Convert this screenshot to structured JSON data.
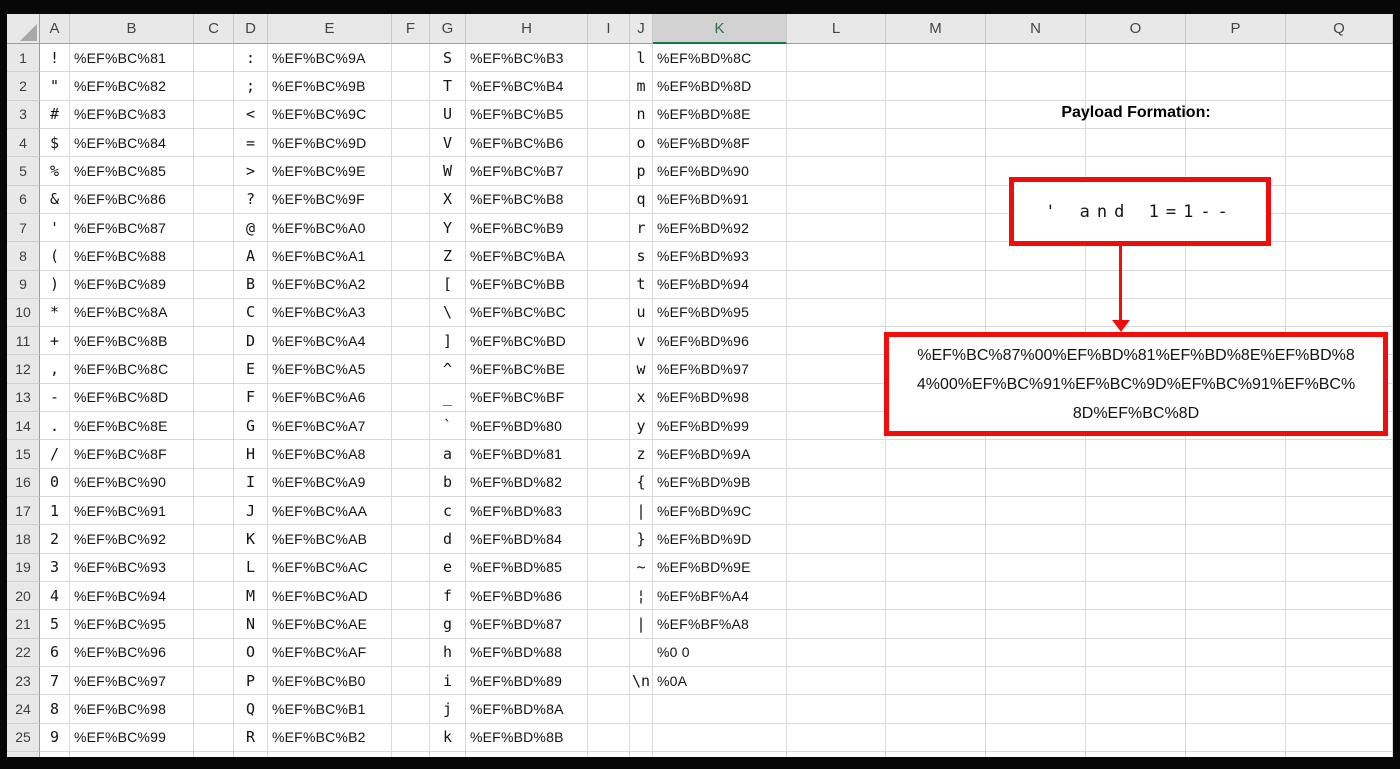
{
  "sheet": {
    "column_headers": [
      "A",
      "B",
      "C",
      "D",
      "E",
      "F",
      "G",
      "H",
      "I",
      "J",
      "K",
      "L",
      "M",
      "N",
      "O",
      "P",
      "Q"
    ],
    "selected_column": "K",
    "row_numbers": [
      1,
      2,
      3,
      4,
      5,
      6,
      7,
      8,
      9,
      10,
      11,
      12,
      13,
      14,
      15,
      16,
      17,
      18,
      19,
      20,
      21,
      22,
      23,
      24,
      25
    ],
    "groups": [
      {
        "char_col": "A",
        "code_col": "B",
        "chars": [
          "!",
          "\"",
          "#",
          "$",
          "%",
          "&",
          "'",
          "(",
          ")",
          "*",
          "+",
          ",",
          "-",
          ".",
          "/",
          "0",
          "1",
          "2",
          "3",
          "4",
          "5",
          "6",
          "7",
          "8",
          "9"
        ],
        "codes": [
          "%EF%BC%81",
          "%EF%BC%82",
          "%EF%BC%83",
          "%EF%BC%84",
          "%EF%BC%85",
          "%EF%BC%86",
          "%EF%BC%87",
          "%EF%BC%88",
          "%EF%BC%89",
          "%EF%BC%8A",
          "%EF%BC%8B",
          "%EF%BC%8C",
          "%EF%BC%8D",
          "%EF%BC%8E",
          "%EF%BC%8F",
          "%EF%BC%90",
          "%EF%BC%91",
          "%EF%BC%92",
          "%EF%BC%93",
          "%EF%BC%94",
          "%EF%BC%95",
          "%EF%BC%96",
          "%EF%BC%97",
          "%EF%BC%98",
          "%EF%BC%99"
        ]
      },
      {
        "char_col": "D",
        "code_col": "E",
        "chars": [
          ":",
          ";",
          "<",
          "=",
          ">",
          "?",
          "@",
          "A",
          "B",
          "C",
          "D",
          "E",
          "F",
          "G",
          "H",
          "I",
          "J",
          "K",
          "L",
          "M",
          "N",
          "O",
          "P",
          "Q",
          "R"
        ],
        "codes": [
          "%EF%BC%9A",
          "%EF%BC%9B",
          "%EF%BC%9C",
          "%EF%BC%9D",
          "%EF%BC%9E",
          "%EF%BC%9F",
          "%EF%BC%A0",
          "%EF%BC%A1",
          "%EF%BC%A2",
          "%EF%BC%A3",
          "%EF%BC%A4",
          "%EF%BC%A5",
          "%EF%BC%A6",
          "%EF%BC%A7",
          "%EF%BC%A8",
          "%EF%BC%A9",
          "%EF%BC%AA",
          "%EF%BC%AB",
          "%EF%BC%AC",
          "%EF%BC%AD",
          "%EF%BC%AE",
          "%EF%BC%AF",
          "%EF%BC%B0",
          "%EF%BC%B1",
          "%EF%BC%B2"
        ]
      },
      {
        "char_col": "G",
        "code_col": "H",
        "chars": [
          "S",
          "T",
          "U",
          "V",
          "W",
          "X",
          "Y",
          "Z",
          "[",
          "\\",
          "]",
          "^",
          "_",
          "`",
          "a",
          "b",
          "c",
          "d",
          "e",
          "f",
          "g",
          "h",
          "i",
          "j",
          "k"
        ],
        "codes": [
          "%EF%BC%B3",
          "%EF%BC%B4",
          "%EF%BC%B5",
          "%EF%BC%B6",
          "%EF%BC%B7",
          "%EF%BC%B8",
          "%EF%BC%B9",
          "%EF%BC%BA",
          "%EF%BC%BB",
          "%EF%BC%BC",
          "%EF%BC%BD",
          "%EF%BC%BE",
          "%EF%BC%BF",
          "%EF%BD%80",
          "%EF%BD%81",
          "%EF%BD%82",
          "%EF%BD%83",
          "%EF%BD%84",
          "%EF%BD%85",
          "%EF%BD%86",
          "%EF%BD%87",
          "%EF%BD%88",
          "%EF%BD%89",
          "%EF%BD%8A",
          "%EF%BD%8B"
        ]
      },
      {
        "char_col": "J",
        "code_col": "K",
        "chars": [
          "l",
          "m",
          "n",
          "o",
          "p",
          "q",
          "r",
          "s",
          "t",
          "u",
          "v",
          "w",
          "x",
          "y",
          "z",
          "{",
          "|",
          "}",
          "~",
          "¦",
          "|",
          "",
          "\\n",
          "",
          ""
        ],
        "codes": [
          "%EF%BD%8C",
          "%EF%BD%8D",
          "%EF%BD%8E",
          "%EF%BD%8F",
          "%EF%BD%90",
          "%EF%BD%91",
          "%EF%BD%92",
          "%EF%BD%93",
          "%EF%BD%94",
          "%EF%BD%95",
          "%EF%BD%96",
          "%EF%BD%97",
          "%EF%BD%98",
          "%EF%BD%99",
          "%EF%BD%9A",
          "%EF%BD%9B",
          "%EF%BD%9C",
          "%EF%BD%9D",
          "%EF%BD%9E",
          "%EF%BF%A4",
          "%EF%BF%A8",
          "%0 0",
          "%0A",
          "",
          ""
        ]
      }
    ]
  },
  "annotation": {
    "title": "Payload Formation:",
    "input_text": "' and 1=1--",
    "encoded_payload": "%EF%BC%87%00%EF%BD%81%EF%BD%8E%EF%BD%84%00%EF%BC%91%EF%BC%9D%EF%BC%91%EF%BC%8D%EF%BC%8D",
    "accent_red": "#f20d0d",
    "selected_header_text_green": "#217346",
    "selected_header_line_green": "#107C41"
  }
}
